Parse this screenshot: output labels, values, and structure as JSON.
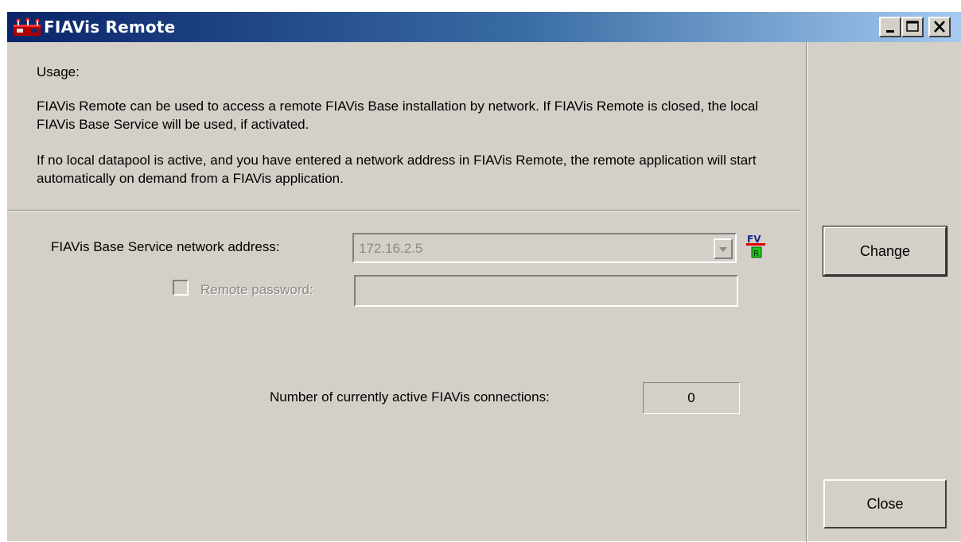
{
  "window": {
    "title": "FIAVis Remote",
    "controls": [
      "minimize",
      "maximize",
      "close"
    ]
  },
  "usage": {
    "label": "Usage:",
    "paragraph1": "FIAVis Remote can be used to access a remote FIAVis Base installation by network. If FIAVis Remote is closed, the local FIAVis Base Service will be used, if activated.",
    "paragraph2": "If no local datapool is active, and you have entered a network address in FIAVis Remote, the remote application will start automatically on demand from a FIAVis application."
  },
  "form": {
    "address_label": "FIAVis Base Service network address:",
    "address_value": "172.16.2.5",
    "password_checkbox_label": "Remote password:",
    "password_checked": false,
    "password_value": "",
    "connections_label": "Number of currently active FIAVis connections:",
    "connections_value": "0"
  },
  "buttons": {
    "change": "Change",
    "close": "Close"
  },
  "colors": {
    "face": "#d4d0c8",
    "title_start": "#0a246a",
    "title_end": "#a6caf0",
    "disabled_text": "#8a8a8a"
  },
  "icons": {
    "app": "fiavis-app-icon",
    "remote": "fiavis-remote-icon"
  }
}
